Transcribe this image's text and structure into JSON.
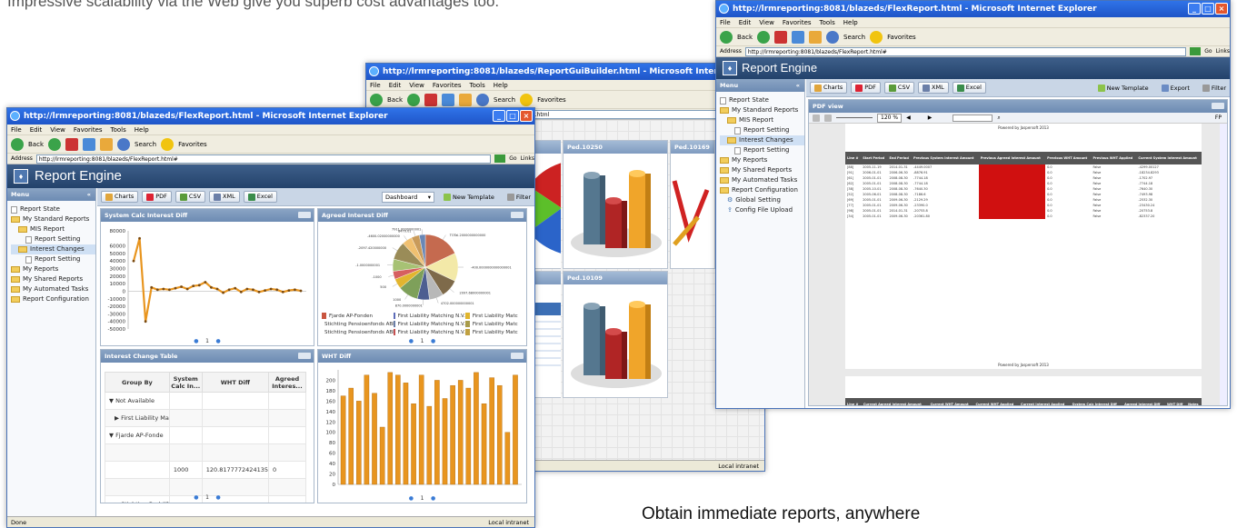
{
  "headline": "Impressive scalability via the Web give you superb cost advantages too.",
  "caption": "Obtain immediate reports, anywhere",
  "browser": {
    "menu": [
      "File",
      "Edit",
      "View",
      "Favorites",
      "Tools",
      "Help"
    ],
    "toolbar": {
      "back": "Back",
      "search": "Search",
      "favorites": "Favorites"
    },
    "address_label": "Address",
    "go": "Go",
    "links": "Links"
  },
  "win_left": {
    "title": "http://lrmreporting:8081/blazeds/FlexReport.html - Microsoft Internet Explorer",
    "address": "http://lrmreporting:8081/blazeds/FlexReport.html#",
    "status": "Done",
    "zone": "Local intranet"
  },
  "win_mid": {
    "title": "http://lrmreporting:8081/blazeds/ReportGuiBuilder.html - Microsoft Internet Explorer",
    "address": "http://lrmreporting:8081/blazeds/ReportGuiBuilder.html",
    "cells": [
      "Ped.10250",
      "Ped.10169",
      "Ped.10109"
    ],
    "zone": "Local intranet"
  },
  "win_right": {
    "title": "http://lrmreporting:8081/blazeds/FlexReport.html - Microsoft Internet Explorer",
    "address": "http://lrmreporting:8081/blazeds/FlexReport.html#",
    "pdf_panel": "PDF view",
    "zoom": "120 %",
    "powered": "Powered by Jaspersoft 2013",
    "ff": "FP"
  },
  "app": {
    "title": "Report Engine",
    "menu_header": "Menu",
    "tree": [
      {
        "label": "Report State",
        "icon": "doc",
        "indent": 0
      },
      {
        "label": "My Standard Reports",
        "icon": "folder",
        "indent": 0
      },
      {
        "label": "MIS Report",
        "icon": "folder",
        "indent": 1
      },
      {
        "label": "Report Setting",
        "icon": "doc",
        "indent": 2
      },
      {
        "label": "Interest Changes",
        "icon": "folder",
        "indent": 1,
        "selected": true
      },
      {
        "label": "Report Setting",
        "icon": "doc",
        "indent": 2
      },
      {
        "label": "My Reports",
        "icon": "folder",
        "indent": 0
      },
      {
        "label": "My Shared Reports",
        "icon": "folder",
        "indent": 0
      },
      {
        "label": "My Automated Tasks",
        "icon": "folder",
        "indent": 0
      },
      {
        "label": "Report Configuration",
        "icon": "folder",
        "indent": 0
      },
      {
        "label": "Global Setting",
        "icon": "gear",
        "indent": 1
      },
      {
        "label": "Config File Upload",
        "icon": "upload",
        "indent": 1
      }
    ],
    "buttons": {
      "charts": "Charts",
      "pdf": "PDF",
      "csv": "CSV",
      "xml": "XML",
      "excel": "Excel"
    },
    "dashboard_select": "Dashboard",
    "new_template": "New Template",
    "export": "Export",
    "filter": "Filter"
  },
  "panels": {
    "p1": "System Calc Interest Diff",
    "p2": "Agreed Interest Diff",
    "p3": "Interest Change Table",
    "p4": "WHT Diff",
    "pager": "1"
  },
  "pie_labels": [
    "Fjarde AP-Fonden",
    "First Liability Matching N.V.",
    "First Liability Matc",
    "Stichting Pensioenfonds ABN Amro",
    "First Liability Matching N.V.",
    "First Liability Matc",
    "Stichting Pensioenfonds ABN Amro",
    "First Liability Matching N.V.",
    "First Liability Matc"
  ],
  "pie_colors": [
    "#c9553f",
    "#5c6bb8",
    "#e0b52e",
    "#8a6e3a",
    "#6b7fa8",
    "#a89b49",
    "#9a9a9a",
    "#c65050",
    "#c0a040"
  ],
  "table": {
    "headers": [
      "Group By",
      "System Calc In...",
      "WHT Diff",
      "Agreed Interes..."
    ],
    "rows": [
      {
        "label": "▼ Not Available",
        "a": "",
        "b": "",
        "c": ""
      },
      {
        "label": "▶ First Liability Ma",
        "a": "",
        "b": "",
        "c": ""
      },
      {
        "label": "▼ Fjarde AP-Fonde",
        "a": "",
        "b": "",
        "c": ""
      },
      {
        "label": "",
        "a": "",
        "b": "",
        "c": ""
      },
      {
        "label": "",
        "a": "1000",
        "b": "120.8177772424135",
        "c": "0"
      },
      {
        "label": "",
        "a": "",
        "b": "",
        "c": ""
      },
      {
        "label": "▶ Stichting Bedrijf",
        "a": "",
        "b": "",
        "c": ""
      },
      {
        "label": "▶ Stichting Pensio",
        "a": "",
        "b": "",
        "c": ""
      }
    ]
  },
  "colors": {
    "accent": "#e8951f",
    "brand": "#2f4f7a"
  },
  "chart_data": [
    {
      "type": "line",
      "title": "System Calc Interest Diff",
      "x": [
        1,
        2,
        3,
        4,
        5,
        6,
        7,
        8,
        9,
        10,
        11,
        12,
        13,
        14,
        15,
        16,
        17,
        18,
        19,
        20,
        21,
        22,
        23,
        24,
        25,
        26,
        27,
        28,
        29
      ],
      "values": [
        40000,
        70000,
        -40000,
        5000,
        2000,
        3000,
        2000,
        4000,
        6000,
        3000,
        7000,
        8000,
        12000,
        5000,
        3000,
        -2000,
        2000,
        4000,
        -1000,
        3000,
        2000,
        -1000,
        1000,
        3000,
        2000,
        -1000,
        1000,
        2000,
        500
      ],
      "ylim": [
        -50000,
        80000
      ],
      "yticks": [
        80000,
        60000,
        50000,
        40000,
        30000,
        20000,
        10000,
        0,
        -10000,
        -20000,
        -30000,
        -40000,
        -50000
      ]
    },
    {
      "type": "pie",
      "title": "Agreed Interest Diff",
      "labels": [
        "TOTal.2000000000000",
        "-400.0000000000000001",
        "2097.68000000001",
        "4702.000000000001",
        "870.0000000001",
        "1000",
        "500",
        "-1000",
        "-1.0000000001",
        "-2097.420000000",
        "-4600.02000000000",
        "8470.01",
        "7911.0000000001"
      ],
      "values": [
        18,
        14,
        9,
        7,
        6,
        10,
        5,
        4,
        6,
        9,
        5,
        4,
        3
      ]
    },
    {
      "type": "bar",
      "title": "WHT Diff",
      "values": [
        170,
        185,
        160,
        210,
        175,
        110,
        215,
        210,
        195,
        155,
        210,
        150,
        200,
        165,
        190,
        200,
        185,
        215,
        155,
        205,
        190,
        100,
        210
      ],
      "ylim": [
        0,
        220
      ],
      "yticks": [
        200,
        180,
        160,
        140,
        120,
        100,
        80,
        60,
        40,
        20,
        0
      ]
    }
  ],
  "pdf_rows": [
    [
      "[88]",
      "2005-11-19",
      "2014-01-31",
      "-4449.0007",
      "",
      "0.0",
      "False",
      "-4299.00127"
    ],
    [
      "[91]",
      "2006-01-01",
      "2006-06-30",
      "-8876.91",
      "",
      "0.0",
      "False",
      "-18234.8293"
    ],
    [
      "[61]",
      "2005-01-01",
      "2008-08-30",
      "-7744.18",
      "",
      "0.0",
      "False",
      "-1702.97"
    ],
    [
      "[62]",
      "2005-01-01",
      "2008-08-30",
      "-7744.18",
      "",
      "0.0",
      "False",
      "-7744.18"
    ],
    [
      "[38]",
      "2005-10-01",
      "2008-08-30",
      "-7640.30",
      "",
      "0.0",
      "False",
      "-7640.30"
    ],
    [
      "[52]",
      "2005-06-01",
      "2008-08-30",
      "-7186.6",
      "",
      "0.0",
      "False",
      "-7493.98"
    ],
    [
      "[69]",
      "2005-01-01",
      "2009-06-30",
      "-2129.29",
      "",
      "0.0",
      "False",
      "-2532.30"
    ],
    [
      "[77]",
      "2005-01-01",
      "2009-06-30",
      "-23390.0",
      "",
      "0.0",
      "False",
      "-23430.24"
    ],
    [
      "[98]",
      "2005-01-01",
      "2014-01-31",
      "-20753.8",
      "",
      "0.0",
      "False",
      "-20753.8"
    ],
    [
      "[34]",
      "2005-01-01",
      "2009-06-30",
      "-20361.80",
      "",
      "0.0",
      "False",
      "-82337.20"
    ]
  ],
  "pdf_headers": [
    "Line #",
    "Start Period",
    "End Period",
    "Previous System Interest Amount",
    "Previous Agreed Interest Amount",
    "Previous WHT Amount",
    "Previous WHT Applied",
    "Current System Interest Amount"
  ],
  "pdf_headers2": [
    "Line #",
    "Current Agreed Interest Amount",
    "Current WHT Amount",
    "Current WHT Applied",
    "Current Interest Applied",
    "System Calc Interest Diff",
    "Agreed Interest Diff",
    "WHT Diff",
    "Notes"
  ]
}
